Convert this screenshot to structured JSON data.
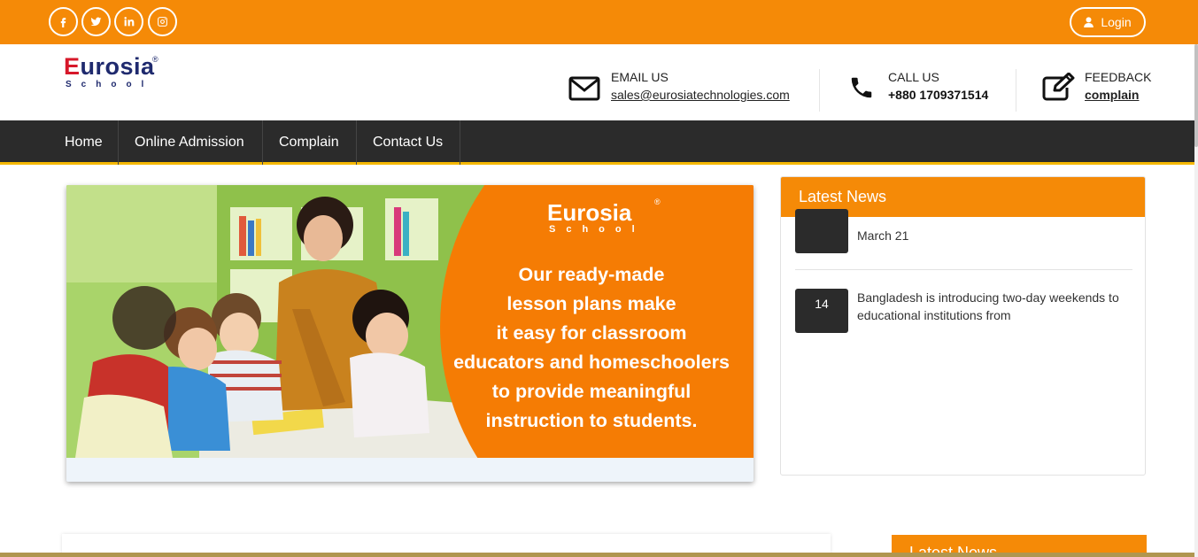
{
  "social": [
    {
      "name": "facebook-icon",
      "glyph": "f"
    },
    {
      "name": "twitter-icon",
      "glyph": "t"
    },
    {
      "name": "linkedin-icon",
      "glyph": "in"
    },
    {
      "name": "instagram-icon",
      "glyph": "ig"
    }
  ],
  "login": {
    "label": "Login"
  },
  "logo": {
    "main": "urosia",
    "first": "E",
    "sub": "School",
    "reg": "®"
  },
  "contacts": {
    "email": {
      "label": "EMAIL US",
      "value": "sales@eurosiatechnologies.com"
    },
    "call": {
      "label": "CALL US",
      "value": "+880 1709371514"
    },
    "feedback": {
      "label": "FEEDBACK",
      "value": "complain"
    }
  },
  "nav": {
    "items": [
      "Home",
      "Online Admission",
      "Complain",
      "Contact Us"
    ]
  },
  "banner": {
    "logo_main": "Eurosia",
    "logo_sub": "School",
    "logo_reg": "®",
    "lines": [
      "Our ready-made",
      "lesson plans make",
      "it easy for classroom",
      "educators and homeschoolers",
      "to provide meaningful",
      "instruction to students."
    ]
  },
  "latest_news": {
    "title": "Latest News",
    "items": [
      {
        "date": "",
        "text": "March 21"
      },
      {
        "date": "14",
        "text": "Bangladesh is introducing two-day weekends to educational institutions from"
      }
    ]
  },
  "lower": {
    "title": "Latest News"
  },
  "colors": {
    "accent": "#f58a07",
    "nav_bg": "#2b2b2b",
    "nav_border": "#f5b800"
  }
}
